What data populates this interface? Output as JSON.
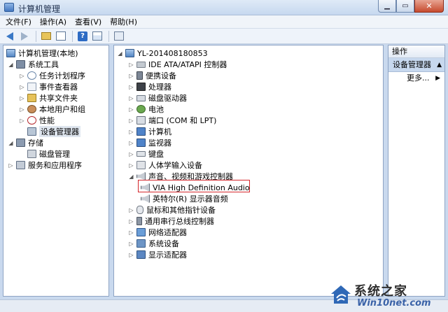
{
  "window": {
    "title": "计算机管理"
  },
  "menu": [
    "文件(F)",
    "操作(A)",
    "查看(V)",
    "帮助(H)"
  ],
  "left_tree": {
    "root": "计算机管理(本地)",
    "system_tools": "系统工具",
    "items": [
      "任务计划程序",
      "事件查看器",
      "共享文件夹",
      "本地用户和组",
      "性能",
      "设备管理器"
    ],
    "storage": "存储",
    "disk_mgmt": "磁盘管理",
    "services": "服务和应用程序"
  },
  "device_tree": {
    "computer": "YL-201408180853",
    "categories": [
      "IDE ATA/ATAPI 控制器",
      "便携设备",
      "处理器",
      "磁盘驱动器",
      "电池",
      "端口 (COM 和 LPT)",
      "计算机",
      "监视器",
      "键盘",
      "人体学输入设备"
    ],
    "sound_category": "声音、视频和游戏控制器",
    "sound_children": [
      "VIA High Definition Audio",
      "英特尔(R) 显示器音频"
    ],
    "more_categories": [
      "鼠标和其他指针设备",
      "通用串行总线控制器",
      "网络适配器",
      "系统设备",
      "显示适配器"
    ]
  },
  "actions": {
    "header": "操作",
    "section": "设备管理器",
    "more": "更多..."
  },
  "watermark": {
    "line1": "系统之家",
    "line2": "Win10net.com"
  },
  "colors": {
    "highlight_box": "#d4262b",
    "accent": "#3b79c6"
  }
}
